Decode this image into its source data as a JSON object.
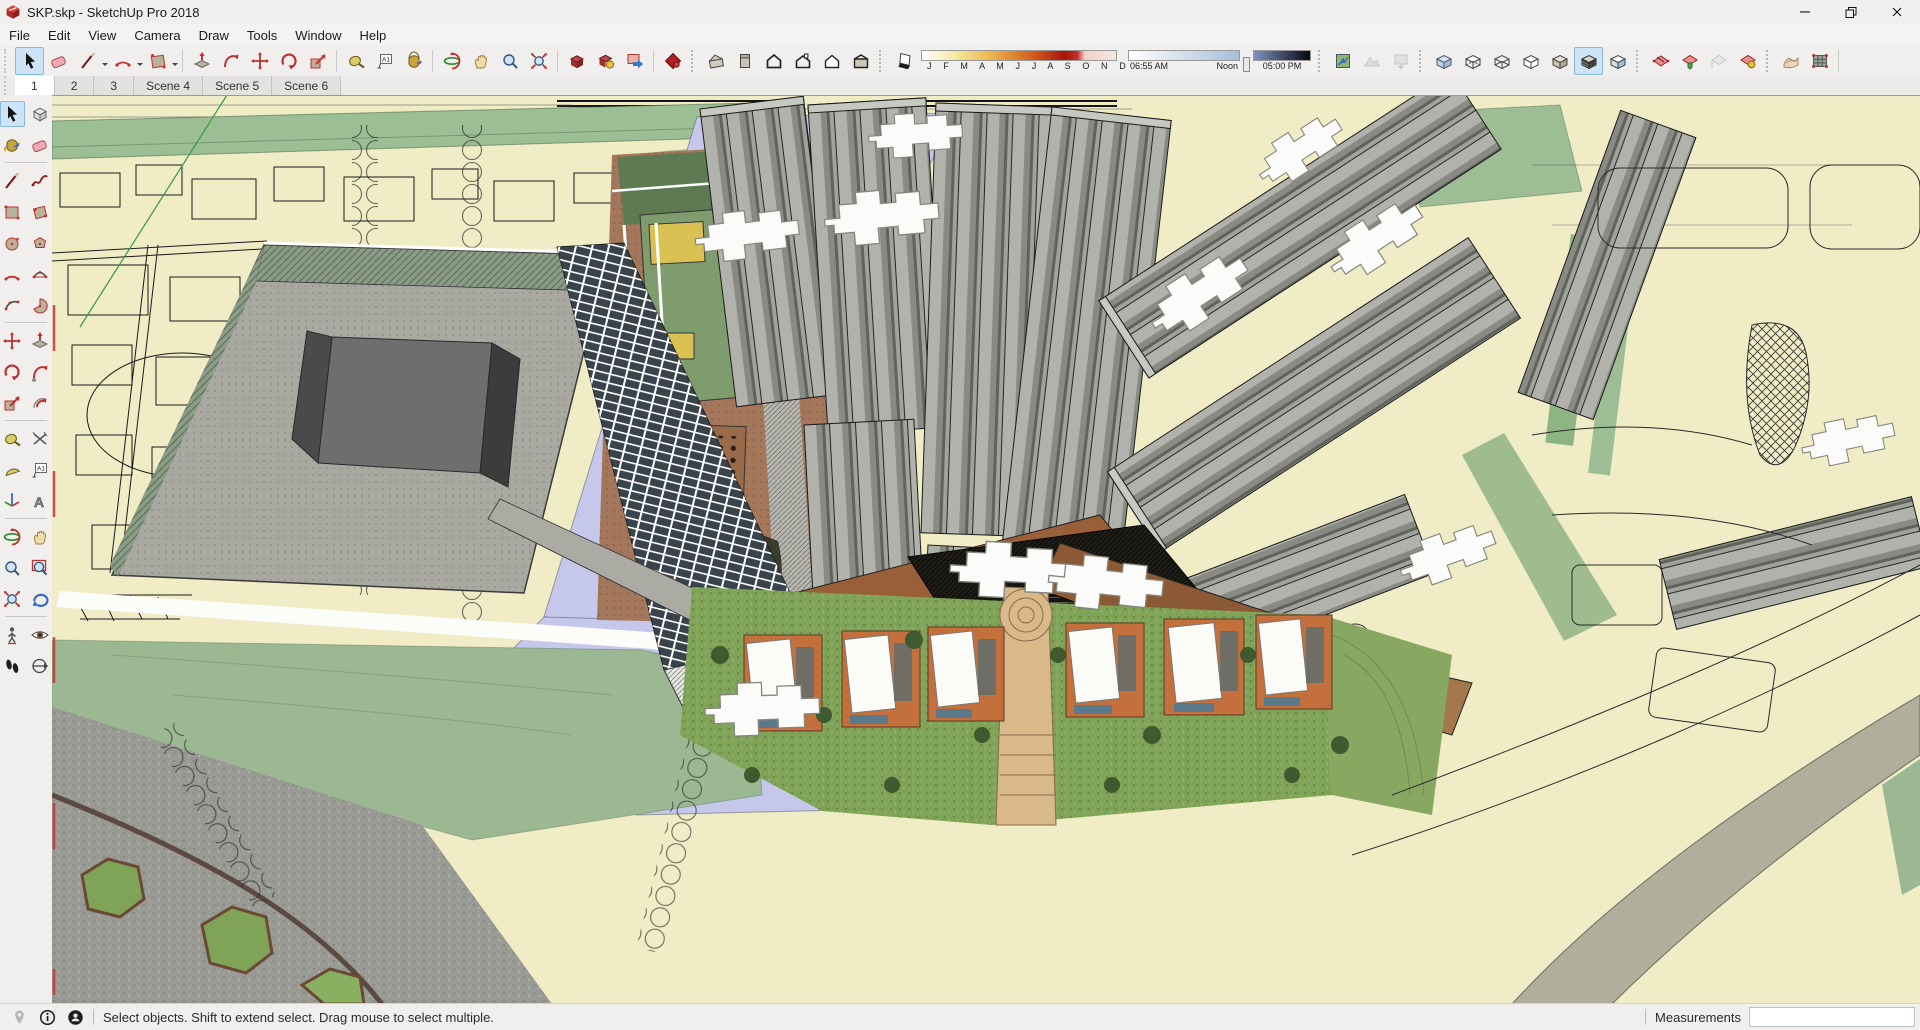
{
  "window": {
    "title": "SKP.skp - SketchUp Pro 2018",
    "controls": [
      "minimize",
      "restore",
      "close"
    ]
  },
  "menu": {
    "items": [
      "File",
      "Edit",
      "View",
      "Camera",
      "Draw",
      "Tools",
      "Window",
      "Help"
    ]
  },
  "toolbar": {
    "principal": [
      "select",
      "eraser",
      "line",
      "arc",
      "rectangle"
    ],
    "edit": [
      "push-pull",
      "follow-me",
      "move",
      "rotate",
      "scale"
    ],
    "construction": [
      "tape-measure",
      "text",
      "paint-bucket"
    ],
    "camera": [
      "orbit",
      "pan",
      "zoom",
      "zoom-extents"
    ],
    "warehouse": [
      "3d-warehouse",
      "share-model",
      "extension-warehouse"
    ],
    "layout": [
      "send-to-layout"
    ],
    "views": [
      "iso",
      "top",
      "front",
      "right",
      "back",
      "left"
    ],
    "shadows": {
      "toggle": "shadow-toggle",
      "months": "J F M A M J J A S O N D",
      "time_start": "06:55 AM",
      "time_noon": "Noon",
      "time_end": "05:00 PM"
    },
    "location": [
      "add-location",
      "toggle-terrain",
      "photo-textures"
    ],
    "styles": [
      "x-ray",
      "back-edges",
      "wireframe",
      "hidden-line",
      "shaded",
      "shaded-with-textures",
      "monochrome"
    ],
    "section": [
      "section-plane",
      "display-section-planes",
      "display-section-cuts",
      "display-section-fill"
    ],
    "sandbox": [
      "from-contours",
      "from-scratch"
    ],
    "text_icon_label": "A1",
    "active_tool": "select",
    "active_style": "shaded-with-textures"
  },
  "scene_tabs": {
    "tabs": [
      "1",
      "2",
      "3",
      "Scene 4",
      "Scene 5",
      "Scene 6"
    ],
    "active": "1"
  },
  "tool_palette": {
    "tools": [
      "select",
      "make-component",
      "paint-bucket",
      "eraser",
      "line",
      "freehand",
      "rectangle",
      "rotated-rectangle",
      "circle",
      "polygon",
      "arc",
      "two-point-arc",
      "three-point-arc",
      "pie",
      "move",
      "push-pull",
      "rotate",
      "follow-me",
      "scale",
      "offset",
      "tape-measure",
      "dimension",
      "protractor",
      "text",
      "axes",
      "3d-text",
      "orbit",
      "pan",
      "zoom",
      "zoom-window",
      "zoom-extents",
      "previous",
      "position-camera",
      "look-around",
      "walk",
      "compass"
    ],
    "active_tool": "select",
    "text_icon_label": "A1"
  },
  "viewport": {
    "colors": {
      "paper": "#EFECC6",
      "green_band": "#9CBE95",
      "sage": "#9CB892",
      "lavender_road": "#C5C8EA",
      "roof_gray": "#A9A9A1",
      "tower_gray": "#A2A29C",
      "white_roof": "#FBFBF9",
      "brown_roof": "#996038",
      "dark_facade": "#14120C",
      "glass_blue": "#8FB6C8",
      "lawn": "#7FA457",
      "townhouse_orange": "#C4703C",
      "path_tan": "#D9B98A"
    }
  },
  "status_bar": {
    "icons": [
      "geolocation",
      "credits",
      "sign-in"
    ],
    "message": "Select objects. Shift to extend select. Drag mouse to select multiple.",
    "measurements_label": "Measurements",
    "measurements_value": ""
  }
}
